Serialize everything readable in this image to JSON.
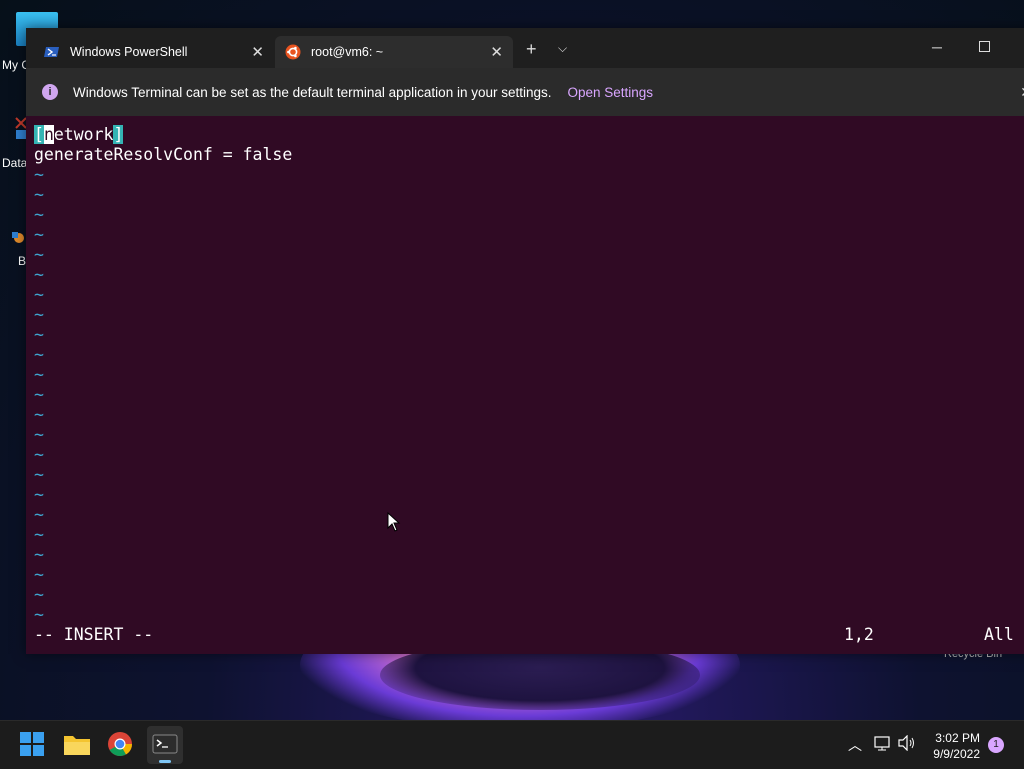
{
  "desktop": {
    "icons": [
      {
        "label": "My C"
      },
      {
        "label": "Data"
      },
      {
        "label": "B"
      }
    ],
    "recycle_bin": "Recycle Bin"
  },
  "terminal": {
    "tabs": [
      {
        "label": "Windows PowerShell",
        "icon": "powershell-icon"
      },
      {
        "label": "root@vm6: ~",
        "icon": "ubuntu-icon",
        "active": true
      }
    ],
    "infobar": {
      "message": "Windows Terminal can be set as the default terminal application in your settings.",
      "link": "Open Settings"
    },
    "editor": {
      "line1_open": "[",
      "line1_cursor": "n",
      "line1_text": "etwork",
      "line1_close": "]",
      "line2": "generateResolvConf = false",
      "empty_marker": "~",
      "mode": "-- INSERT --",
      "position": "1,2",
      "scroll": "All"
    }
  },
  "taskbar": {
    "time": "3:02 PM",
    "date": "9/9/2022",
    "notification_count": "1"
  },
  "colors": {
    "terminal_bg": "#300a24",
    "tilde": "#3ea6d0",
    "link": "#d9a6ff"
  }
}
